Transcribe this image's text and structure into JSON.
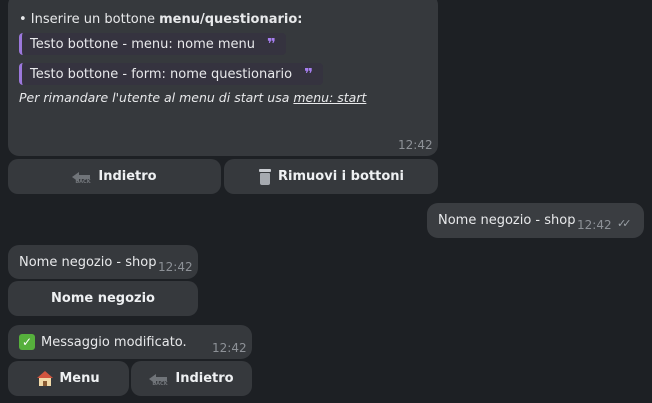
{
  "msg1": {
    "bullet_prefix": "• Inserire un bottone ",
    "bullet_bold": "menu/questionario:",
    "quote1": "Testo bottone - menu: nome menu",
    "quote2": "Testo bottone - form: nome questionario",
    "note_prefix": "Per rimandare l'utente al menu di start usa ",
    "note_link": "menu: start",
    "time": "12:42",
    "buttons": [
      {
        "label": "Indietro",
        "icon": "back-icon"
      },
      {
        "label": "Rimuovi i bottoni",
        "icon": "wastebasket-icon"
      }
    ]
  },
  "msg_out": {
    "text": "Nome negozio - shop",
    "time": "12:42",
    "status": "read-double-check"
  },
  "msg2": {
    "text": "Nome negozio - shop",
    "time": "12:42",
    "button": "Nome negozio"
  },
  "msg3": {
    "text": "Messaggio modificato.",
    "time": "12:42",
    "icon": "check-mark-button-icon",
    "buttons": [
      {
        "label": "Menu",
        "icon": "house-icon"
      },
      {
        "label": "Indietro",
        "icon": "back-icon"
      }
    ]
  },
  "colors": {
    "background": "#1d2024",
    "bubble": "#36393d",
    "quote_accent": "#9c78dc"
  }
}
